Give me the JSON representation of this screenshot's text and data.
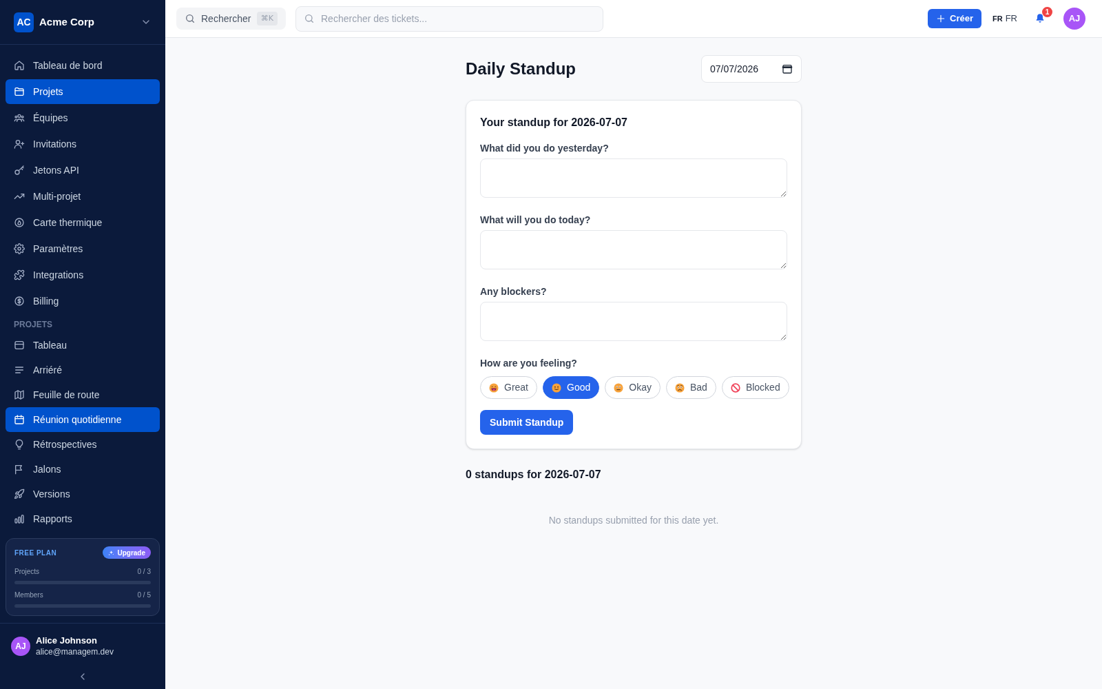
{
  "workspace": {
    "initials": "AC",
    "name": "Acme Corp"
  },
  "sidebar": {
    "items": [
      {
        "label": "Tableau de bord",
        "selected": false
      },
      {
        "label": "Projets",
        "selected": true
      },
      {
        "label": "Équipes",
        "selected": false
      },
      {
        "label": "Invitations",
        "selected": false
      },
      {
        "label": "Jetons API",
        "selected": false
      },
      {
        "label": "Multi-projet",
        "selected": false
      },
      {
        "label": "Carte thermique",
        "selected": false
      },
      {
        "label": "Paramètres",
        "selected": false
      },
      {
        "label": "Integrations",
        "selected": false
      },
      {
        "label": "Billing",
        "selected": false
      }
    ],
    "section_title": "PROJETS",
    "project_items": [
      {
        "label": "Tableau",
        "selected": false
      },
      {
        "label": "Arriéré",
        "selected": false
      },
      {
        "label": "Feuille de route",
        "selected": false
      },
      {
        "label": "Réunion quotidienne",
        "selected": true
      },
      {
        "label": "Rétrospectives",
        "selected": false
      },
      {
        "label": "Jalons",
        "selected": false
      },
      {
        "label": "Versions",
        "selected": false
      },
      {
        "label": "Rapports",
        "selected": false
      }
    ]
  },
  "plan": {
    "title": "FREE PLAN",
    "upgrade_button": "Upgrade",
    "quotas": [
      {
        "label": "Projects",
        "reading": "0 / 3",
        "level": 0
      },
      {
        "label": "Members",
        "reading": "0 / 5",
        "level": 0
      }
    ]
  },
  "user": {
    "initials": "AJ",
    "name": "Alice Johnson",
    "email": "alice@managem.dev"
  },
  "topbar": {
    "quick_search": {
      "label": "Rechercher",
      "shortcut": "⌘K"
    },
    "ticket_search": {
      "placeholder": "Rechercher des tickets..."
    },
    "create_button": "Créer",
    "language": {
      "flag": "FR",
      "code": "FR"
    },
    "notifications": {
      "count": "1"
    },
    "avatar": "AJ"
  },
  "page": {
    "title": "Daily Standup",
    "date": "07/07/2026"
  },
  "form": {
    "heading": "Your standup for 2026-07-07",
    "fields": [
      {
        "label": "What did you do yesterday?"
      },
      {
        "label": "What will you do today?"
      },
      {
        "label": "Any blockers?"
      }
    ],
    "mood": {
      "label": "How are you feeling?",
      "options": [
        {
          "label": "Great",
          "selected": false
        },
        {
          "label": "Good",
          "selected": true
        },
        {
          "label": "Okay",
          "selected": false
        },
        {
          "label": "Bad",
          "selected": false
        },
        {
          "label": "Blocked",
          "selected": false
        }
      ]
    },
    "submit_button": "Submit Standup"
  },
  "standups": {
    "heading": "0 standups for 2026-07-07",
    "empty_message": "No standups submitted for this date yet."
  }
}
